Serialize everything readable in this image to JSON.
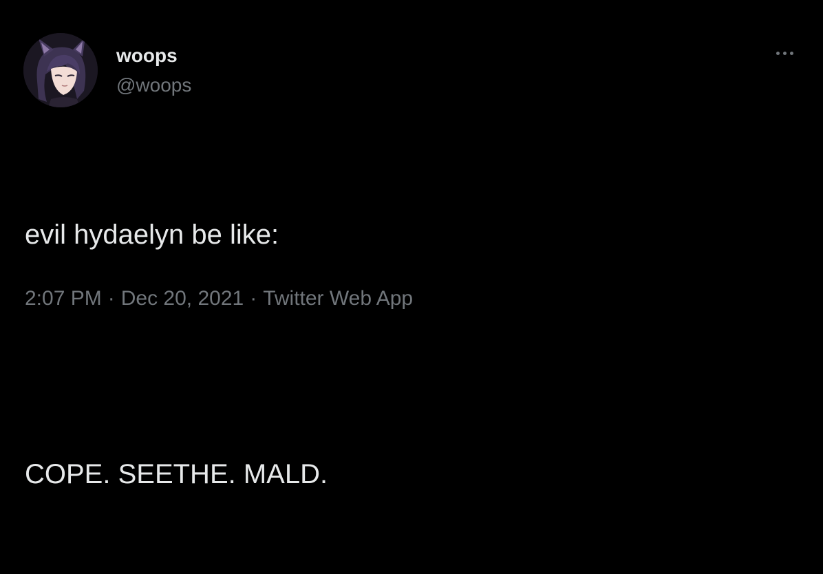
{
  "colors": {
    "background": "#000000",
    "primary_text": "#e7e9ea",
    "secondary_text": "#71767b"
  },
  "author": {
    "display_name": "woops",
    "handle": "@woops",
    "avatar_icon": "avatar-anime-character"
  },
  "menu": {
    "icon": "more-horizontal-icon"
  },
  "tweet": {
    "lines": [
      "evil hydaelyn be like:",
      "",
      "COPE. SEETHE. MALD."
    ]
  },
  "meta": {
    "time": "2:07 PM",
    "separator": "·",
    "date": "Dec 20, 2021",
    "source": "Twitter Web App"
  }
}
